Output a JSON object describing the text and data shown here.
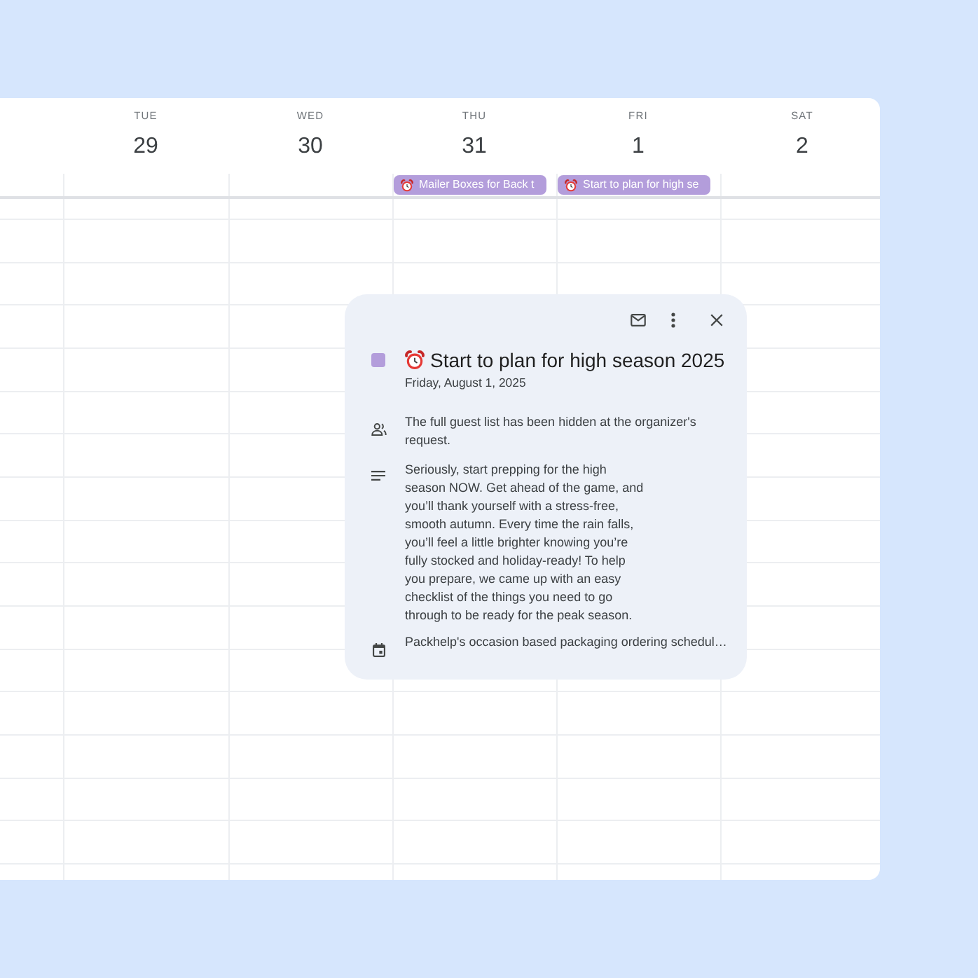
{
  "calendar": {
    "days": [
      {
        "weekday": "TUE",
        "date": "29"
      },
      {
        "weekday": "WED",
        "date": "30"
      },
      {
        "weekday": "THU",
        "date": "31",
        "events": [
          {
            "title": "Mailer Boxes for Back t",
            "color": "#b39ddb"
          }
        ]
      },
      {
        "weekday": "FRI",
        "date": "1",
        "events": [
          {
            "title": "Start to plan for high se",
            "color": "#b39ddb"
          }
        ]
      },
      {
        "weekday": "SAT",
        "date": "2"
      }
    ]
  },
  "event_popup": {
    "title": "Start to plan for high season 2025",
    "color": "#b39ddb",
    "date": "Friday, August 1, 2025",
    "details": [
      {
        "kind": "guests",
        "text": "The full guest list has been hidden at the organizer's request."
      },
      {
        "kind": "description",
        "text": "Seriously, start prepping for the high season NOW. Get ahead of the game, and you’ll thank yourself with a stress-free, smooth autumn. Every time the rain falls, you’ll feel a little brighter knowing you’re fully stocked and holiday-ready! To help you prepare, we came up with an easy checklist of the things you need to go through to be ready for the peak season."
      },
      {
        "kind": "calendar",
        "text": "Packhelp's occasion based packaging ordering schedul…"
      }
    ]
  }
}
